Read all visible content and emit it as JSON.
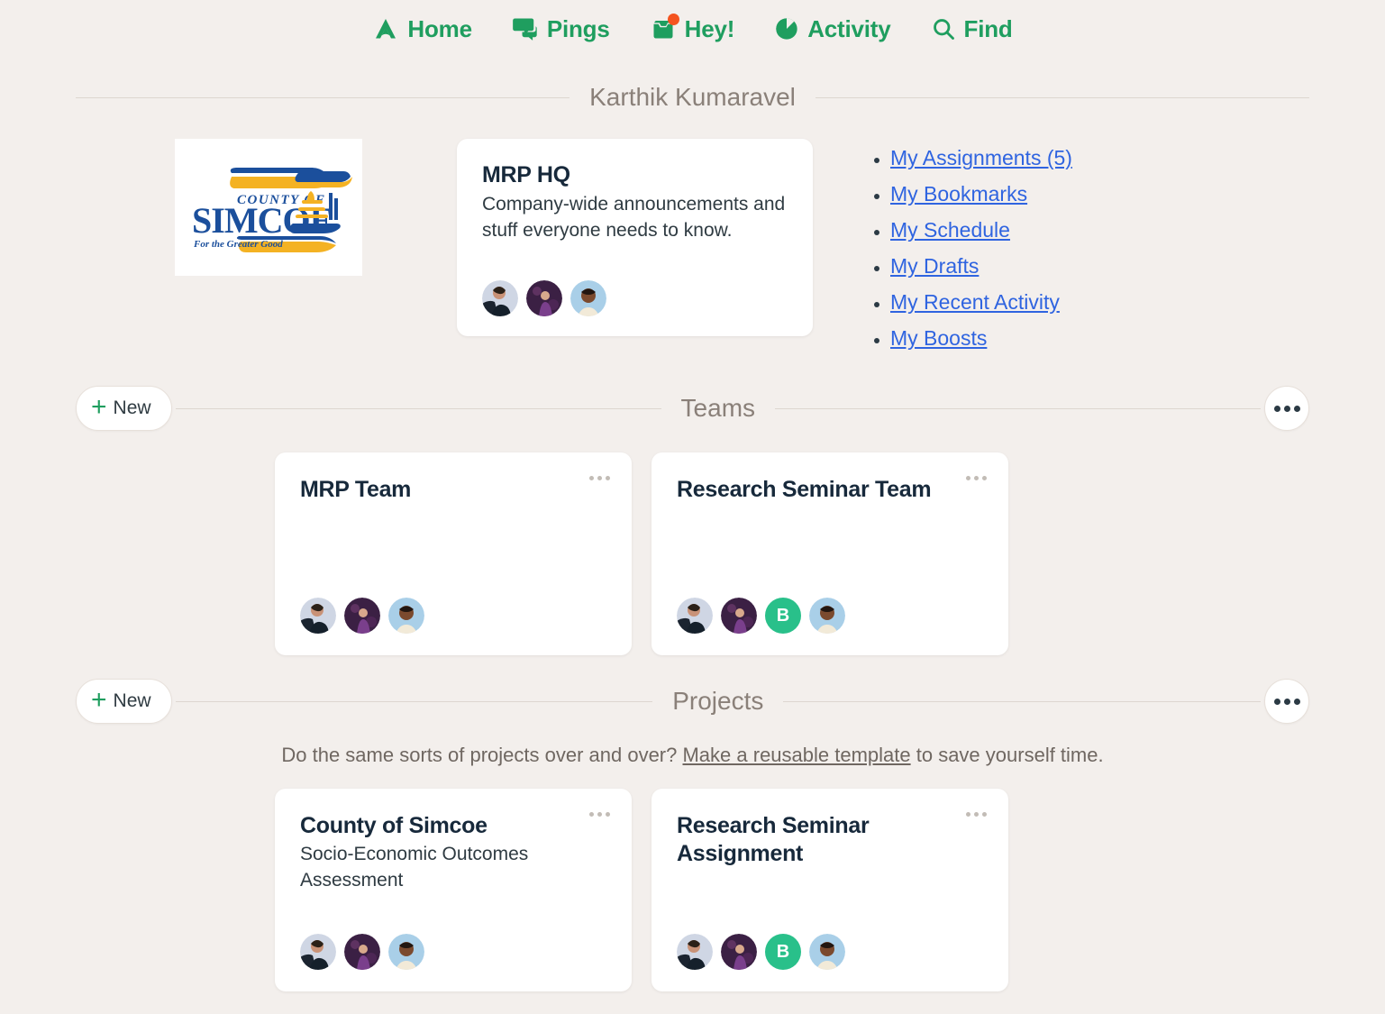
{
  "nav": {
    "items": [
      {
        "label": "Home",
        "icon": "home-icon",
        "badge": false
      },
      {
        "label": "Pings",
        "icon": "chat-icon",
        "badge": false
      },
      {
        "label": "Hey!",
        "icon": "inbox-icon",
        "badge": true
      },
      {
        "label": "Activity",
        "icon": "pie-icon",
        "badge": false
      },
      {
        "label": "Find",
        "icon": "search-icon",
        "badge": false
      }
    ],
    "accent_color": "#1f9e5f",
    "badge_color": "#f4531f"
  },
  "person": {
    "name": "Karthik Kumaravel"
  },
  "logo": {
    "alt": "County of Simcoe",
    "line_top": "COUNTY OF",
    "line_main": "SIMCOE",
    "tagline": "For the Greater Good",
    "blue": "#1b4f9c",
    "yellow": "#f4b223"
  },
  "hq_card": {
    "title": "MRP HQ",
    "description": "Company-wide announcements and stuff everyone needs to know.",
    "avatars": [
      "woman-blazer",
      "person-purple",
      "man-light-shirt"
    ]
  },
  "quick_links": [
    {
      "label": "My Assignments (5)"
    },
    {
      "label": "My Bookmarks"
    },
    {
      "label": "My Schedule"
    },
    {
      "label": "My Drafts"
    },
    {
      "label": "My Recent Activity"
    },
    {
      "label": "My Boosts"
    }
  ],
  "teams_section": {
    "title": "Teams",
    "new_label": "New",
    "cards": [
      {
        "title": "MRP Team",
        "subtitle": "",
        "avatars": [
          "woman-blazer",
          "person-purple",
          "man-light-shirt"
        ]
      },
      {
        "title": "Research Seminar Team",
        "subtitle": "",
        "avatars": [
          "woman-blazer",
          "person-purple",
          "initial-B",
          "man-light-shirt"
        ]
      }
    ]
  },
  "projects_section": {
    "title": "Projects",
    "new_label": "New",
    "helper_prefix": "Do the same sorts of projects over and over? ",
    "helper_link": "Make a reusable template",
    "helper_suffix": " to save yourself time.",
    "cards": [
      {
        "title": "County of Simcoe",
        "subtitle": "Socio-Economic Outcomes Assessment",
        "avatars": [
          "woman-blazer",
          "person-purple",
          "man-light-shirt"
        ]
      },
      {
        "title": "Research Seminar Assignment",
        "subtitle": "",
        "avatars": [
          "woman-blazer",
          "person-purple",
          "initial-B",
          "man-light-shirt"
        ]
      }
    ]
  },
  "avatar_initial": {
    "letter": "B",
    "color": "#29c08a"
  }
}
